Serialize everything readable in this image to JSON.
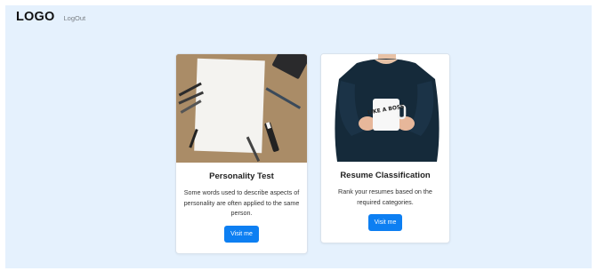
{
  "navbar": {
    "logo": "LOGO",
    "logout_label": "LogOut"
  },
  "cards": [
    {
      "title": "Personality Test",
      "description": "Some words used to describe aspects of personality are often applied to the same person.",
      "button_label": "Visit me"
    },
    {
      "title": "Resume Classification",
      "description": "Rank your resumes based on the required categories.",
      "button_label": "Visit me",
      "mug_text": "LIKE A BOSS"
    }
  ],
  "colors": {
    "page_bg": "#e5f1fd",
    "button": "#0d7ff2",
    "card_bg": "#ffffff"
  }
}
